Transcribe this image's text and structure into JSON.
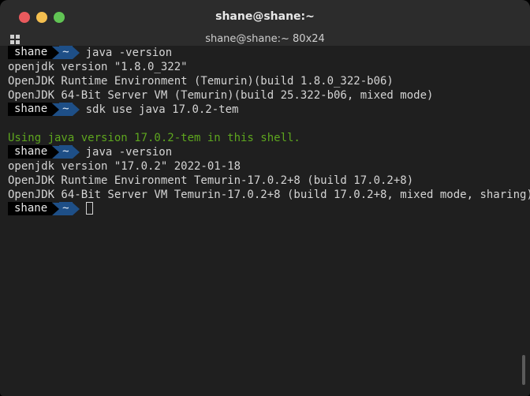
{
  "window": {
    "title": "shane@shane:~"
  },
  "tab": {
    "title": "shane@shane:~ 80x24"
  },
  "prompt": {
    "user": "shane",
    "dir": "~"
  },
  "lines": [
    {
      "type": "prompt",
      "cmd": "java -version"
    },
    {
      "type": "output",
      "text": "openjdk version \"1.8.0_322\""
    },
    {
      "type": "output",
      "text": "OpenJDK Runtime Environment (Temurin)(build 1.8.0_322-b06)"
    },
    {
      "type": "output",
      "text": "OpenJDK 64-Bit Server VM (Temurin)(build 25.322-b06, mixed mode)"
    },
    {
      "type": "prompt",
      "cmd": "sdk use java 17.0.2-tem"
    },
    {
      "type": "blank",
      "text": ""
    },
    {
      "type": "highlight",
      "text": "Using java version 17.0.2-tem in this shell."
    },
    {
      "type": "prompt",
      "cmd": "java -version"
    },
    {
      "type": "output",
      "text": "openjdk version \"17.0.2\" 2022-01-18"
    },
    {
      "type": "output",
      "text": "OpenJDK Runtime Environment Temurin-17.0.2+8 (build 17.0.2+8)"
    },
    {
      "type": "output",
      "text": "OpenJDK 64-Bit Server VM Temurin-17.0.2+8 (build 17.0.2+8, mixed mode, sharing)"
    },
    {
      "type": "prompt",
      "cmd": ""
    }
  ],
  "colors": {
    "prompt_dir_bg": "#1e4f87",
    "highlight": "#5ea61f",
    "terminal_bg": "#1f1f1f"
  }
}
